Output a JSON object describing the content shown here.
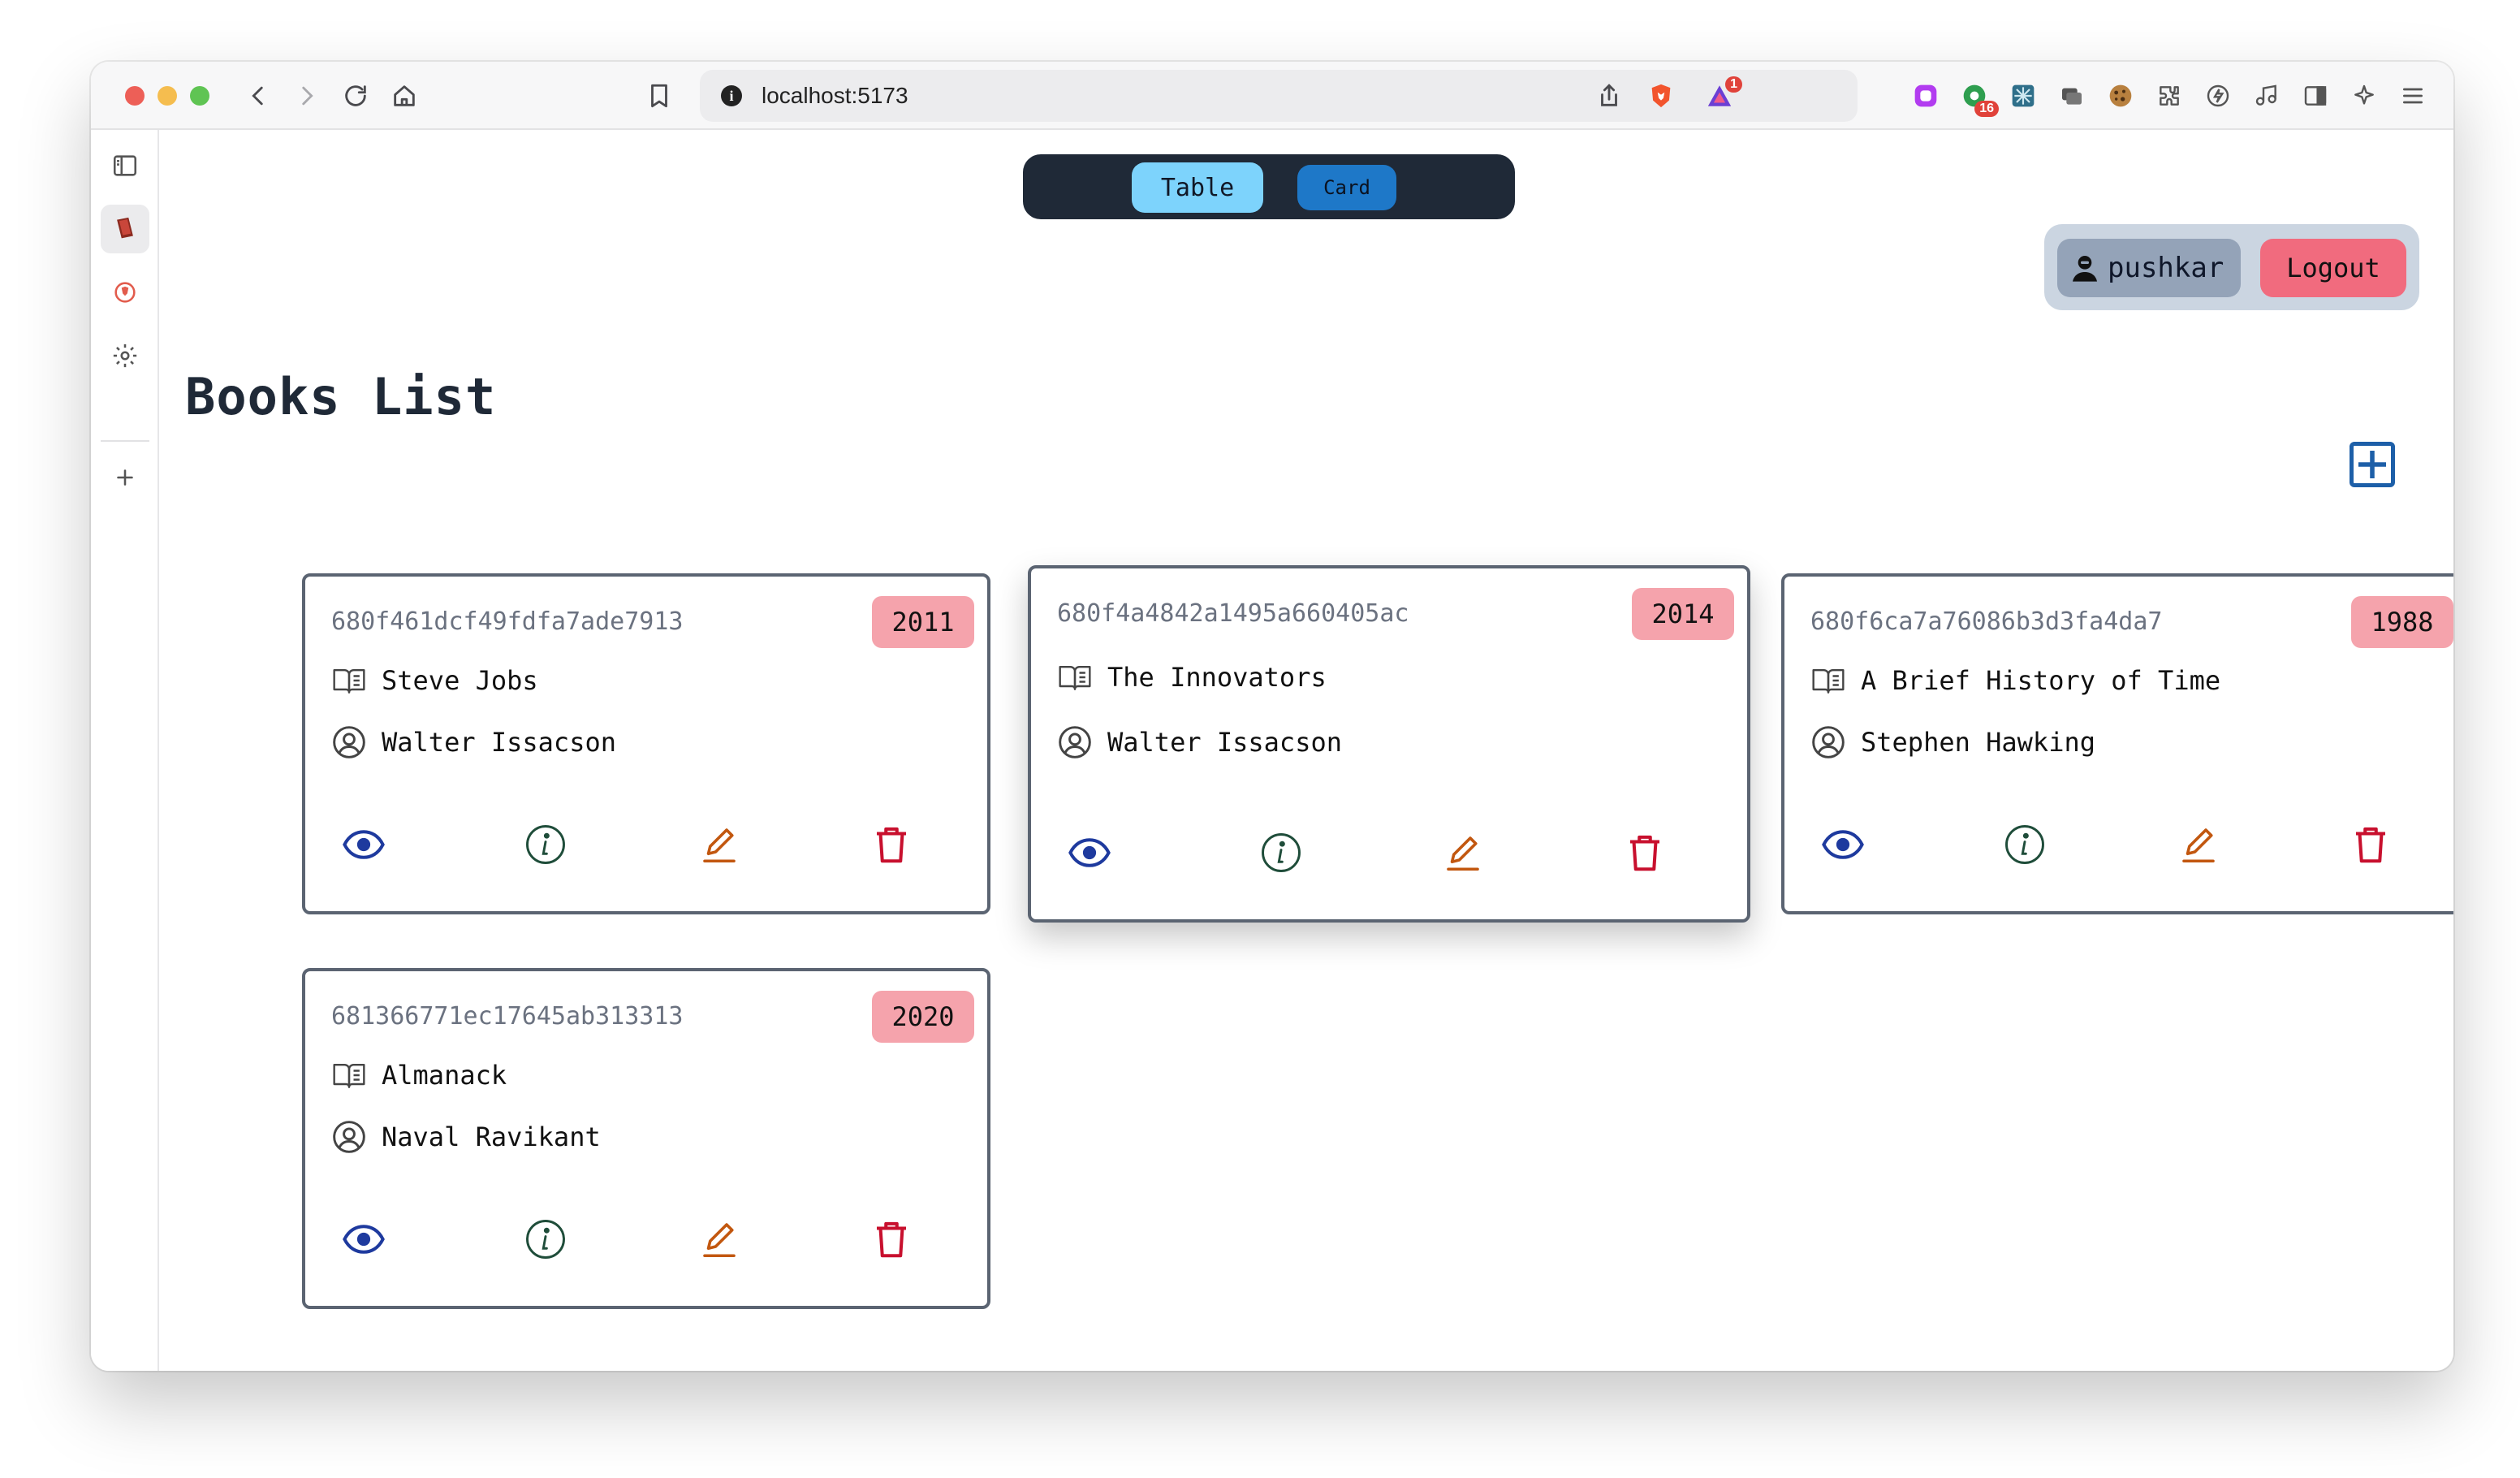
{
  "browser": {
    "url": "localhost:5173",
    "extension_badge_count": "16",
    "alert_badge_count": "1"
  },
  "view_toggle": {
    "table_label": "Table",
    "card_label": "Card"
  },
  "user": {
    "name": "pushkar",
    "logout_label": "Logout"
  },
  "page_title": "Books List",
  "books": [
    {
      "id": "680f461dcf49fdfa7ade7913",
      "year": "2011",
      "title": "Steve Jobs",
      "author": "Walter Issacson"
    },
    {
      "id": "680f4a4842a1495a660405ac",
      "year": "2014",
      "title": "The Innovators",
      "author": "Walter Issacson"
    },
    {
      "id": "680f6ca7a76086b3d3fa4da7",
      "year": "1988",
      "title": "A Brief History of Time",
      "author": "Stephen Hawking"
    },
    {
      "id": "681366771ec17645ab313313",
      "year": "2020",
      "title": "Almanack",
      "author": "Naval Ravikant"
    }
  ],
  "colors": {
    "view_icon": "#1e3a9e",
    "info_icon": "#1f4d3a",
    "edit_icon": "#c2570f",
    "delete_icon": "#c8102e",
    "year_badge": "#f5a3ac",
    "logout": "#f16b7e"
  }
}
